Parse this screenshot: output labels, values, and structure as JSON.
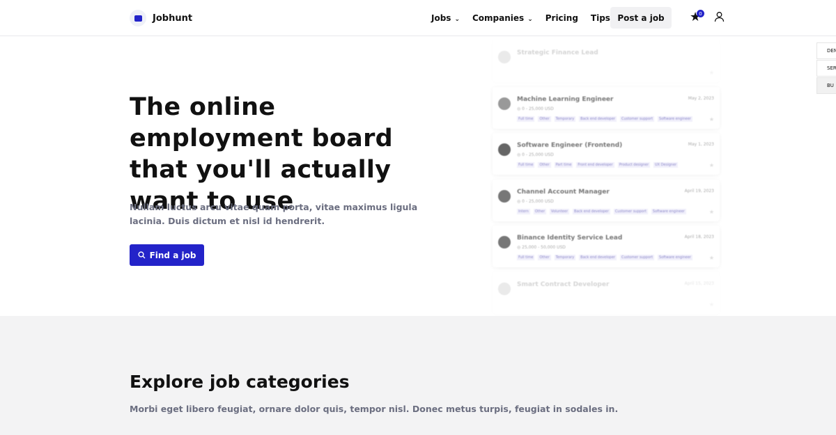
{
  "nav": {
    "brand": "Jobhunt",
    "items": [
      {
        "label": "Jobs",
        "dropdown": true
      },
      {
        "label": "Companies",
        "dropdown": true
      },
      {
        "label": "Pricing"
      },
      {
        "label": "Tips"
      }
    ],
    "post_label": "Post a job",
    "favorites_count": "0",
    "accent": "#2323c9"
  },
  "hero": {
    "title": "The online employment board that you'll actually want to use",
    "subtitle": "Nullam luctus arcu vitae quam porta, vitae maximus ligula lacinia. Duis dictum et nisl id hendrerit.",
    "cta": "Find a job"
  },
  "jobs": [
    {
      "title": "Strategic Finance Lead",
      "date": "",
      "salary": "",
      "tags": [],
      "faded": true,
      "avatar": "#bbb"
    },
    {
      "title": "Machine Learning Engineer",
      "date": "May 2, 2023",
      "salary": "0 - 25,000 USD",
      "tags": [
        "Full time",
        "Other",
        "Temporary",
        "Back end developer",
        "Customer support",
        "Software engineer"
      ],
      "avatar": "#999"
    },
    {
      "title": "Software Engineer (Frontend)",
      "date": "May 1, 2023",
      "salary": "0 - 25,000 USD",
      "tags": [
        "Full time",
        "Other",
        "Part time",
        "Front end developer",
        "Product designer",
        "UX Designer"
      ],
      "avatar": "#666"
    },
    {
      "title": "Channel Account Manager",
      "date": "April 19, 2023",
      "salary": "0 - 25,000 USD",
      "tags": [
        "Intern",
        "Other",
        "Volunteer",
        "Back end developer",
        "Customer support",
        "Software engineer"
      ],
      "avatar": "#777"
    },
    {
      "title": "Binance Identity Service Lead",
      "date": "April 18, 2023",
      "salary": "25,000 - 50,000 USD",
      "tags": [
        "Full time",
        "Other",
        "Temporary",
        "Back end developer",
        "Customer support",
        "Software engineer"
      ],
      "avatar": "#777"
    },
    {
      "title": "Smart Contract Developer",
      "date": "April 15, 2023",
      "salary": "",
      "tags": [],
      "faded": true,
      "avatar": "#bbb"
    }
  ],
  "side_menu": [
    "DEM",
    "SERV",
    "BU"
  ],
  "categories": {
    "title": "Explore job categories",
    "subtitle": "Morbi eget libero feugiat, ornare dolor quis, tempor nisl. Donec metus turpis, feugiat in sodales in."
  }
}
